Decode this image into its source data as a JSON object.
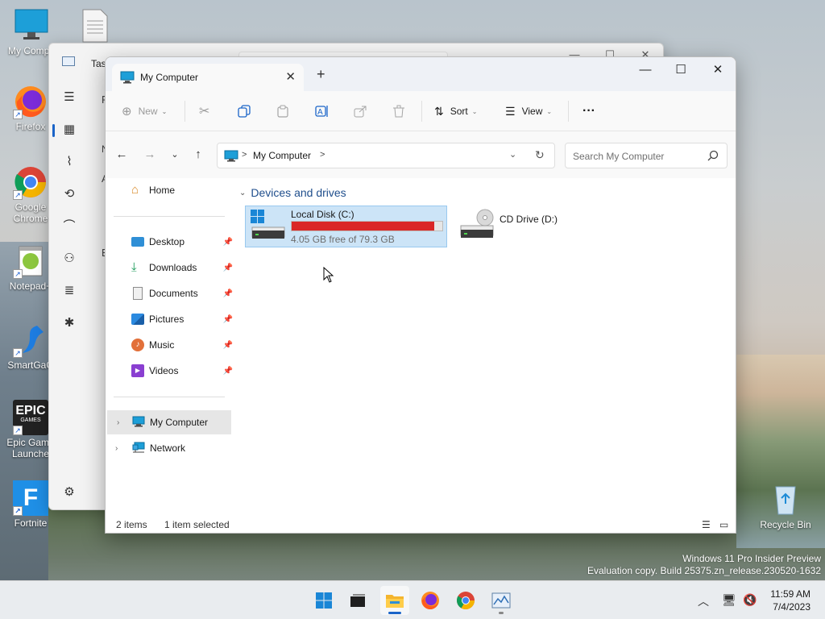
{
  "desktop": {
    "icons": [
      {
        "label": "My Compu",
        "icon": "computer-icon"
      },
      {
        "label": "Firefox",
        "icon": "firefox-icon"
      },
      {
        "label": "Google Chrome",
        "icon": "chrome-icon"
      },
      {
        "label": "Notepad+",
        "icon": "notepadpp-icon"
      },
      {
        "label": "SmartGaG",
        "icon": "smartgit-icon"
      },
      {
        "label": "Epic Game Launche",
        "icon": "epic-games-icon"
      },
      {
        "label": "Fortnite",
        "icon": "fortnite-icon"
      }
    ],
    "recycle_bin_label": "Recycle Bin",
    "epic_logo_text": "EPIC",
    "epic_logo_sub": "GAMES",
    "fortnite_letter": "F"
  },
  "task_manager": {
    "title": "Tas",
    "peek_letters": [
      "P",
      "N",
      "A",
      "E"
    ]
  },
  "explorer": {
    "tab_title": "My Computer",
    "toolbar": {
      "new_label": "New",
      "sort_label": "Sort",
      "view_label": "View",
      "more_label": "···"
    },
    "address": {
      "path_label": "My Computer",
      "separator": ">"
    },
    "search": {
      "placeholder": "Search My Computer"
    },
    "sidebar": {
      "home": "Home",
      "quick_access": [
        {
          "label": "Desktop",
          "icon": "desktop-folder-icon"
        },
        {
          "label": "Downloads",
          "icon": "downloads-icon"
        },
        {
          "label": "Documents",
          "icon": "documents-icon"
        },
        {
          "label": "Pictures",
          "icon": "pictures-icon"
        },
        {
          "label": "Music",
          "icon": "music-icon"
        },
        {
          "label": "Videos",
          "icon": "videos-icon"
        }
      ],
      "tree": [
        {
          "label": "My Computer",
          "icon": "computer-icon",
          "selected": true
        },
        {
          "label": "Network",
          "icon": "network-icon",
          "selected": false
        }
      ]
    },
    "content": {
      "section_title": "Devices and drives",
      "drives": [
        {
          "name": "Local Disk (C:)",
          "free_text": "4.05 GB free of 79.3 GB",
          "used_fraction": 0.949,
          "selected": true,
          "icon": "hard-drive-icon"
        },
        {
          "name": "CD Drive (D:)",
          "selected": false,
          "icon": "cd-drive-icon"
        }
      ]
    },
    "status": {
      "item_count": "2 items",
      "selection": "1 item selected"
    },
    "colors": {
      "accent": "#1a64c8",
      "disk_bar": "#da2626",
      "selection_bg": "#cce4f7"
    }
  },
  "watermark": {
    "line1": "Windows 11 Pro Insider Preview",
    "line2": "Evaluation copy. Build 25375.zn_release.230520-1632"
  },
  "taskbar": {
    "time": "11:59 AM",
    "date": "7/4/2023",
    "apps": [
      "start-icon",
      "task-view-icon",
      "file-explorer-icon",
      "firefox-icon",
      "chrome-icon",
      "task-manager-icon"
    ]
  }
}
